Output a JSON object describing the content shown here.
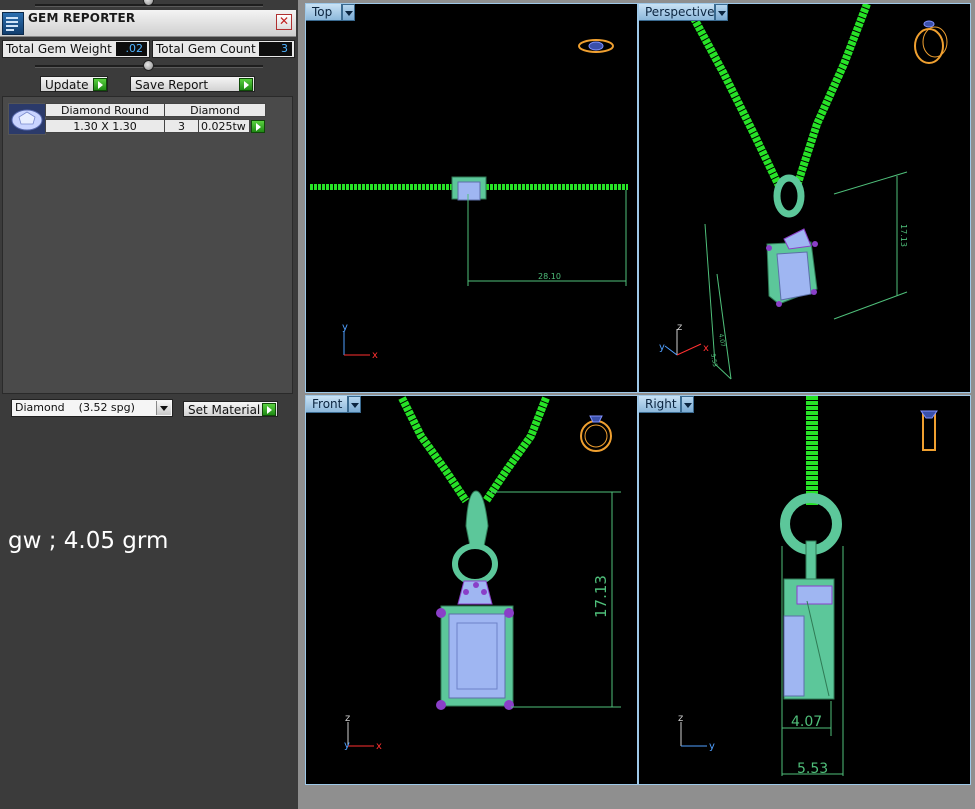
{
  "panel": {
    "title": "GEM REPORTER",
    "close": "✕",
    "total_weight_label": "Total Gem Weight",
    "total_weight_value": ".02",
    "total_count_label": "Total Gem Count",
    "total_count_value": "3",
    "update_label": "Update",
    "save_label": "Save Report",
    "gem_table": {
      "headers": [
        "Diamond Round",
        "Diamond"
      ],
      "row": {
        "size": "1.30 X 1.30",
        "count": "3",
        "weight": "0.025tw"
      }
    },
    "material_selected": "Diamond    (3.52 spg)",
    "set_material_label": "Set Material",
    "note": "gw ; 4.05 grm"
  },
  "viewports": {
    "top": {
      "label": "Top",
      "dimension": "28.10",
      "axis_v": "y",
      "axis_h": "x"
    },
    "perspective": {
      "label": "Perspective",
      "dimension": "17.13",
      "dim_small_a": "4.07",
      "dim_small_b": "5.53",
      "axis_v": "z",
      "axis_a": "y",
      "axis_b": "x"
    },
    "front": {
      "label": "Front",
      "dimension": "17.13",
      "axis_v": "z",
      "axis_h": "x",
      "axis_d": "y"
    },
    "right": {
      "label": "Right",
      "dim_a": "4.07",
      "dim_b": "5.53",
      "axis_v": "z",
      "axis_h": "y"
    }
  },
  "colors": {
    "chain": "#27e327",
    "metal": "#5cc79a",
    "stone": "#9fb6f2",
    "prong": "#8a3fc8",
    "dimension": "#4fbf7a",
    "ring_icon": "#f0a030",
    "axis_x": "#ff3030",
    "axis_y": "#50a0ff",
    "axis_z": "#d0d0d0"
  }
}
